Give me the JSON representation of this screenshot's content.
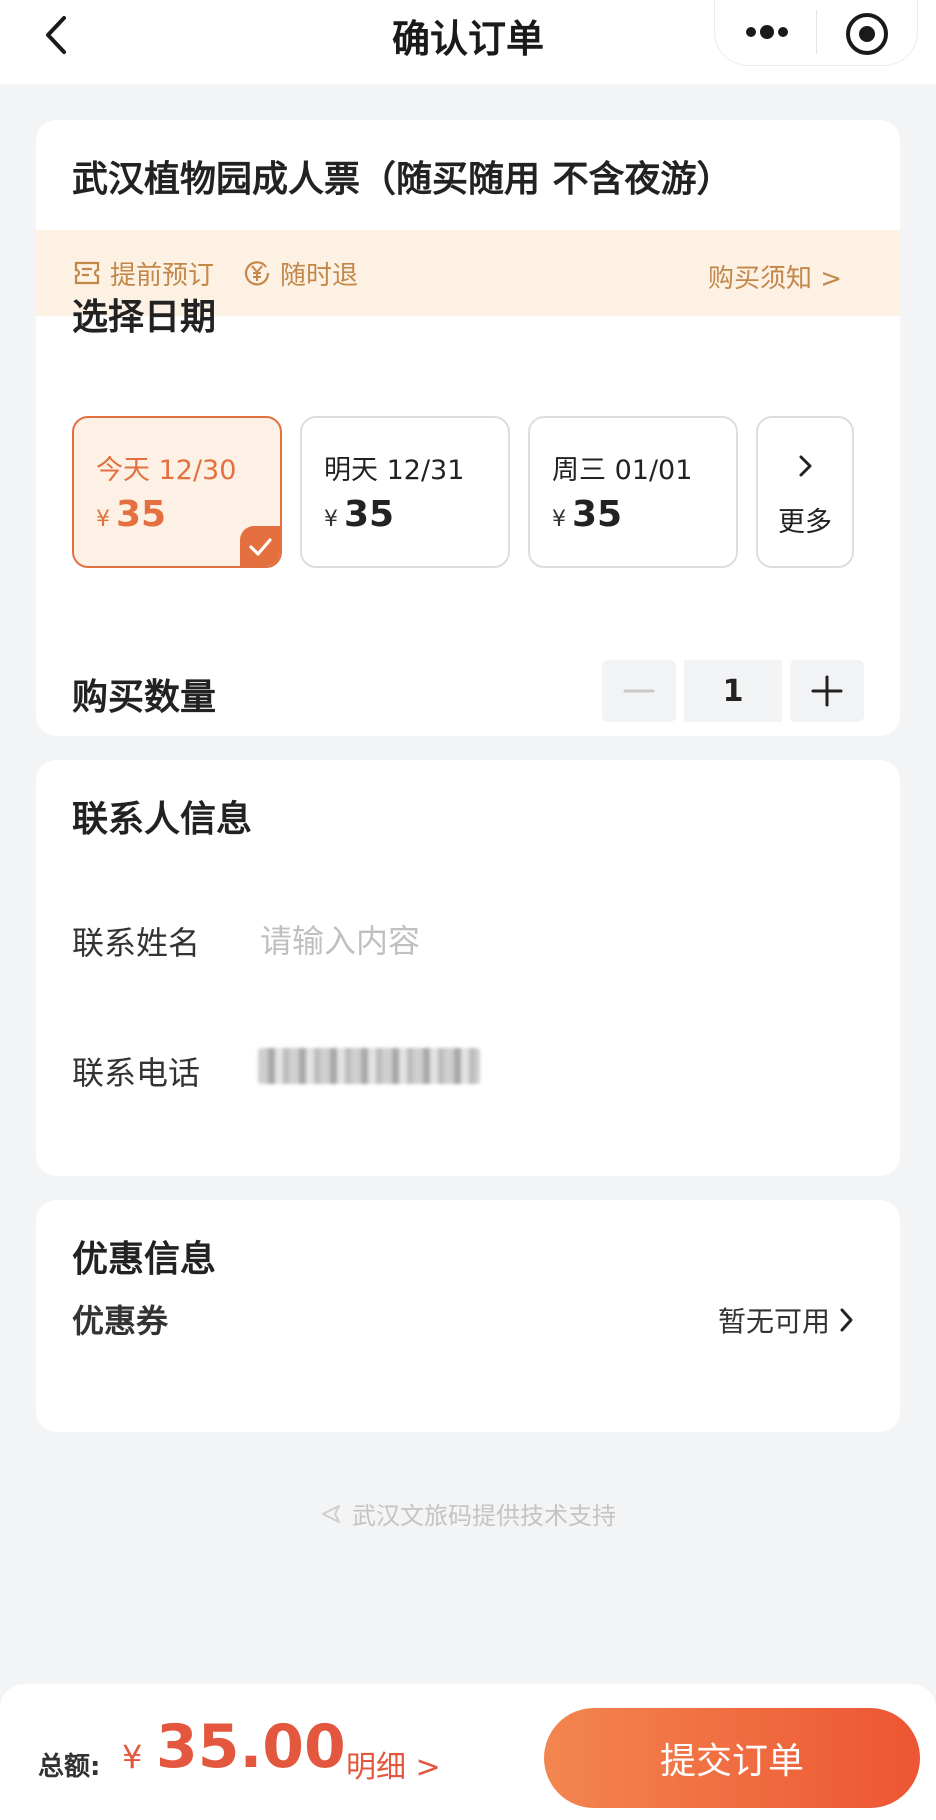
{
  "nav": {
    "title": "确认订单",
    "back_icon": "chevron-left-icon",
    "more_icon": "more-dots-icon",
    "close_icon": "target-icon"
  },
  "ticket": {
    "title": "武汉植物园成人票（随买随用 不含夜游）",
    "tags": [
      {
        "icon": "ticket-icon",
        "label": "提前预订"
      },
      {
        "icon": "yen-refund-icon",
        "label": "随时退"
      }
    ],
    "notice_link": "购买须知 >"
  },
  "date_section": {
    "title": "选择日期",
    "options": [
      {
        "label": "今天 12/30",
        "currency": "¥",
        "price": "35",
        "selected": true
      },
      {
        "label": "明天 12/31",
        "currency": "¥",
        "price": "35",
        "selected": false
      },
      {
        "label": "周三 01/01",
        "currency": "¥",
        "price": "35",
        "selected": false
      }
    ],
    "more_label": "更多"
  },
  "quantity": {
    "title": "购买数量",
    "value": "1"
  },
  "contact": {
    "title": "联系人信息",
    "name_label": "联系姓名",
    "name_placeholder": "请输入内容",
    "phone_label": "联系电话"
  },
  "discount": {
    "title": "优惠信息",
    "coupon_label": "优惠券",
    "coupon_value": "暂无可用"
  },
  "support_text": "武汉文旅码提供技术支持",
  "bottom": {
    "total_label": "总额:",
    "currency": "¥",
    "amount": "35.00",
    "detail_link": "明细 >",
    "submit_label": "提交订单"
  },
  "colors": {
    "accent": "#e4703f",
    "price_red": "#e3573f",
    "notice_bg": "#fdf1e3",
    "notice_text": "#c3874a"
  }
}
